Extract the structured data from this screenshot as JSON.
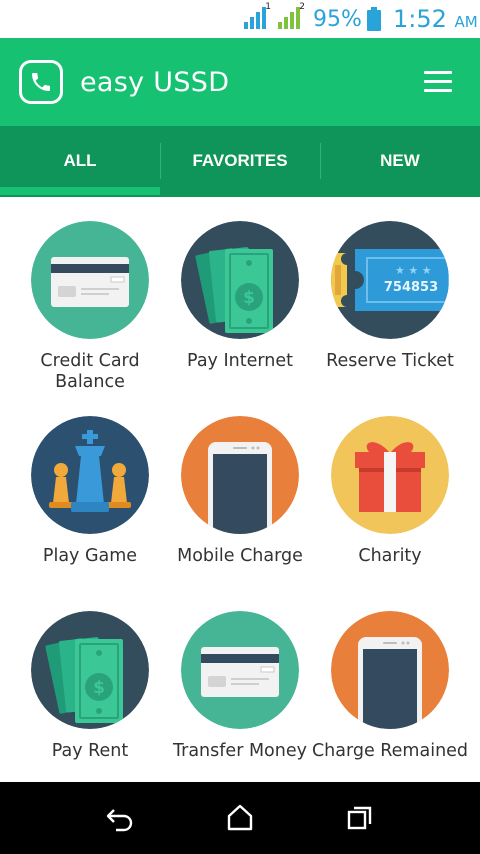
{
  "status_bar": {
    "sim1_label": "1",
    "sim2_label": "2",
    "battery_percent": "95%",
    "time": "1:52",
    "ampm": "AM",
    "icons": [
      "signal-sim1-icon",
      "signal-sim2-icon",
      "battery-icon"
    ],
    "colors": {
      "text": "#2aa3d8"
    }
  },
  "app_bar": {
    "title": "easy USSD",
    "logo_icon": "phone-icon",
    "menu_icon": "hamburger-menu-icon",
    "colors": {
      "background": "#16c172"
    }
  },
  "tabs": {
    "items": [
      {
        "label": "ALL",
        "selected": true
      },
      {
        "label": "FAVORITES",
        "selected": false
      },
      {
        "label": "NEW",
        "selected": false
      }
    ],
    "colors": {
      "background": "#0f9559",
      "indicator": "#16c172"
    }
  },
  "services": [
    {
      "label": "Credit Card Balance",
      "icon": "credit-card-icon"
    },
    {
      "label": "Pay Internet",
      "icon": "money-bills-icon"
    },
    {
      "label": "Reserve Ticket",
      "icon": "ticket-icon"
    },
    {
      "label": "Play Game",
      "icon": "chess-pieces-icon"
    },
    {
      "label": "Mobile Charge",
      "icon": "smartphone-icon"
    },
    {
      "label": "Charity",
      "icon": "gift-box-icon"
    },
    {
      "label": "Pay Rent",
      "icon": "money-bills-icon"
    },
    {
      "label": "Transfer Money",
      "icon": "credit-card-icon"
    },
    {
      "label": "Charge Remained",
      "icon": "smartphone-icon"
    }
  ],
  "ticket_number": "754853",
  "nav_bar": {
    "icons": [
      "back-icon",
      "home-icon",
      "recent-apps-icon"
    ]
  }
}
